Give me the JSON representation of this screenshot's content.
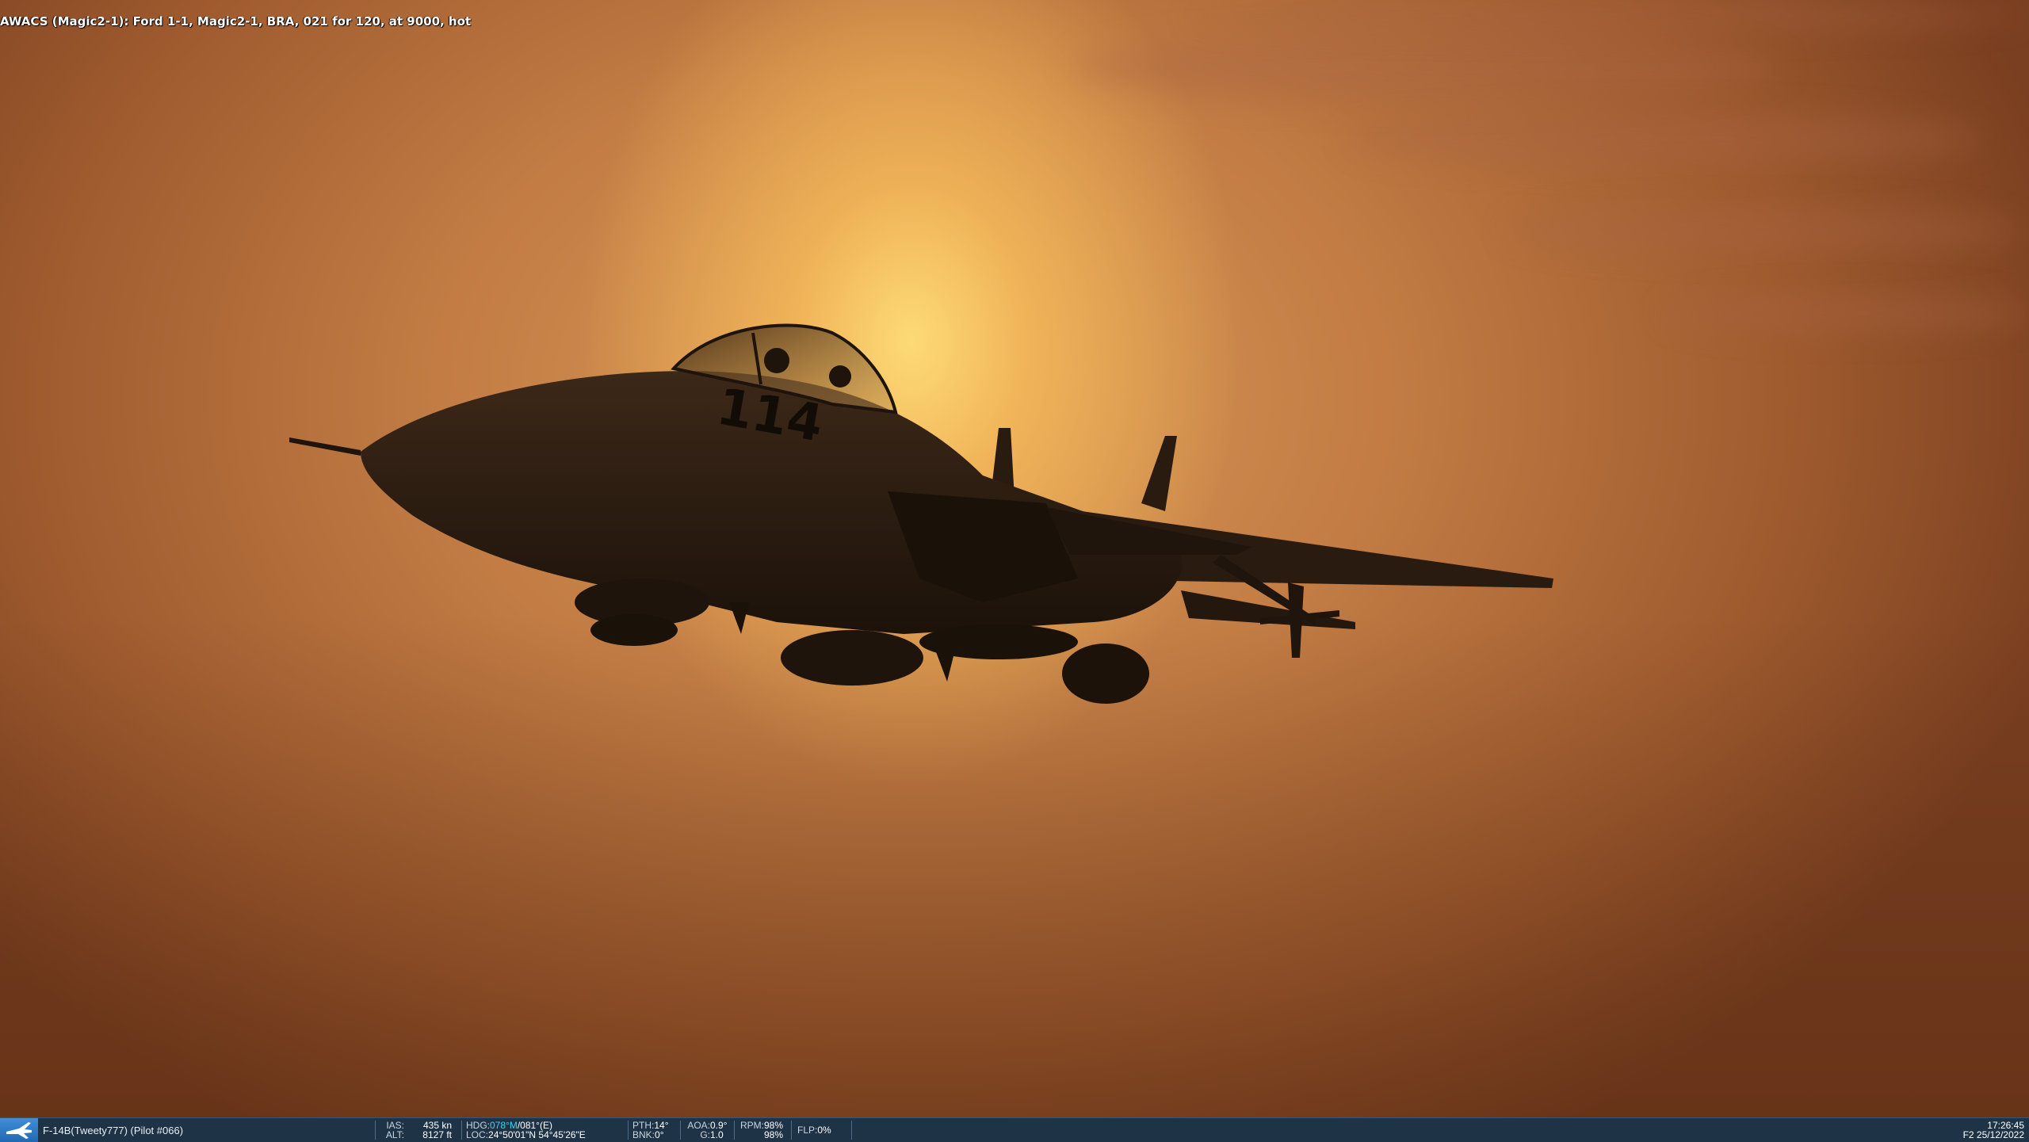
{
  "hud": {
    "awacs_message": "AWACS (Magic2-1): Ford 1-1, Magic2-1, BRA, 021 for 120, at 9000, hot"
  },
  "aircraft": {
    "tail_number": "114",
    "icon": "jet-fighter-silhouette"
  },
  "statusbar": {
    "unit_icon": "aircraft-icon",
    "unit_name": "F-14B(Tweety777) (Pilot #066)",
    "ias_label": "IAS:",
    "ias_value": "435 kn",
    "alt_label": "ALT:",
    "alt_value": "8127 ft",
    "hdg_label": "HDG:",
    "hdg_magnetic": "078°M",
    "hdg_true": "/081°(E)",
    "loc_label": "LOC:",
    "loc_value": "24°50'01\"N 54°45'26\"E",
    "pth_label": "PTH:",
    "pth_value": "14°",
    "bnk_label": "BNK:",
    "bnk_value": "0°",
    "aoa_label": "AOA:",
    "aoa_value": "0.9°",
    "g_label": "G:",
    "g_value": "1.0",
    "rpm_label": "RPM:",
    "rpm_left": "98%",
    "rpm_right": "98%",
    "flp_label": "FLP:",
    "flp_value": "0%",
    "time": "17:26:45",
    "date": "F2 25/12/2022"
  },
  "colors": {
    "statusbar_bg": "#1f3347",
    "heading_accent": "#39d7ea",
    "unit_icon_bg": "#2f7fd0"
  }
}
